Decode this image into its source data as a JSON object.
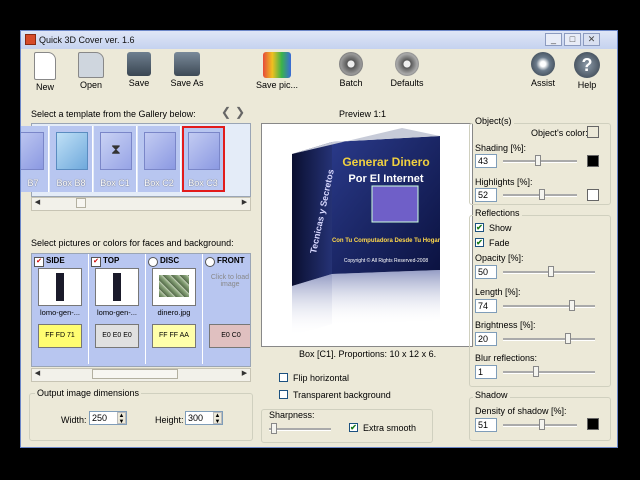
{
  "window": {
    "title": "Quick 3D Cover ver. 1.6"
  },
  "toolbar": {
    "new": "New",
    "open": "Open",
    "save": "Save",
    "save_as": "Save As",
    "save_pic": "Save pic...",
    "batch": "Batch",
    "defaults": "Defaults",
    "assist": "Assist",
    "help": "Help"
  },
  "gallery": {
    "label": "Select a template from the Gallery below:",
    "tiles": [
      "B7",
      "Box B8",
      "Box C1",
      "Box C2",
      "Box C3"
    ]
  },
  "faces": {
    "label": "Select pictures or colors for faces and background:",
    "items": [
      {
        "name": "SIDE",
        "file": "lomo-gen-...",
        "color": "FF FD 71",
        "hex": "#FFFD71"
      },
      {
        "name": "TOP",
        "file": "lomo-gen-...",
        "color": "E0 E0 E0",
        "hex": "#E0E0E0"
      },
      {
        "name": "DISC",
        "file": "dinero.jpg",
        "color": "FF FF AA",
        "hex": "#FFFFAA"
      },
      {
        "name": "FRONT",
        "file": "Click to load image",
        "color": "E0 C0",
        "hex": "#E0C0C0"
      }
    ]
  },
  "output": {
    "label": "Output image dimensions",
    "width_label": "Width:",
    "width": "250",
    "height_label": "Height:",
    "height": "300"
  },
  "preview": {
    "label": "Preview 1:1",
    "box_title_1": "Generar Dinero",
    "box_title_2": "Por El Internet",
    "box_side": "Tecnicas y Secretos",
    "box_sub": "Con Tu Computadora Desde Tu Hogar",
    "box_copy": "Copyright © All Rights Reserved-2008",
    "caption": "Box [C1]. Proportions: 10 x 12 x 6.",
    "flip": "Flip horizontal",
    "transparent": "Transparent background"
  },
  "sharpness": {
    "label": "Sharpness:",
    "extra_smooth": "Extra smooth",
    "extra_checked": true
  },
  "objects": {
    "title": "Object(s)",
    "color_label": "Object's color:",
    "shading_label": "Shading [%]:",
    "shading": "43",
    "highlights_label": "Highlights [%]:",
    "highlights": "52"
  },
  "reflections": {
    "title": "Reflections",
    "show": "Show",
    "fade": "Fade",
    "opacity_label": "Opacity [%]:",
    "opacity": "50",
    "length_label": "Length [%]:",
    "length": "74",
    "brightness_label": "Brightness [%]:",
    "brightness": "20",
    "blur_label": "Blur reflections:",
    "blur": "1"
  },
  "shadow": {
    "title": "Shadow",
    "density_label": "Density of shadow [%]:",
    "density": "51"
  }
}
